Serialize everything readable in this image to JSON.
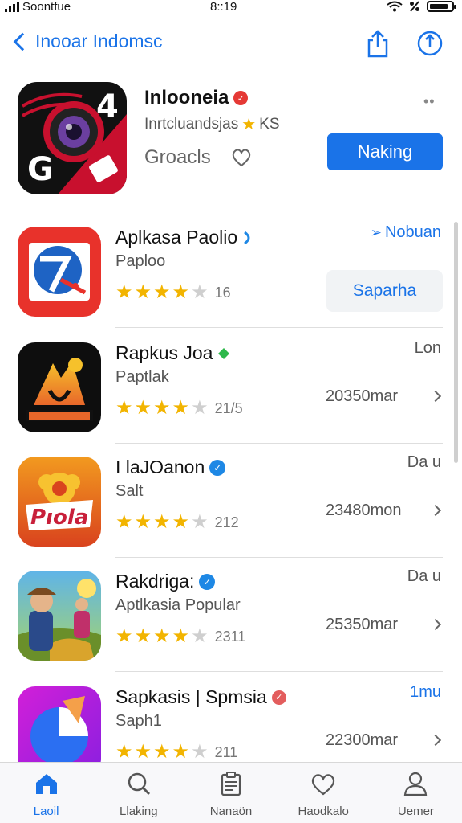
{
  "status_bar": {
    "carrier": "Soontfue",
    "time": "8::19"
  },
  "nav": {
    "back_label": "Inooar Indomsc"
  },
  "featured": {
    "title": "Inlooneia",
    "subtitle": "Inrtcluandsjas",
    "rating_suffix": "KS",
    "category": "Groacls",
    "button_label": "Naking",
    "more": "••"
  },
  "apps": [
    {
      "name": "Aplkasa Paolio",
      "subtitle": "Paploo",
      "rating_count": "16",
      "action_label": "Nobuan",
      "button_label": "Saparha",
      "stars": 4
    },
    {
      "name": "Rapkus Joa",
      "subtitle": "Paptlak",
      "rating_count": "21/5",
      "action_label": "Lon",
      "price": "20350mar",
      "stars": 4
    },
    {
      "name": "I laJOanon",
      "subtitle": "Salt",
      "rating_count": "212",
      "action_label": "Da u",
      "price": "23480mon",
      "stars": 4
    },
    {
      "name": "Rakdriga:",
      "subtitle": "Aptlkasia Popular",
      "rating_count": "2311",
      "action_label": "Da u",
      "price": "25350mar",
      "stars": 4
    },
    {
      "name": "Sapkasis | Spmsia",
      "subtitle": "Saph1",
      "rating_count": "211",
      "action_label": "1mu",
      "price": "22300mar",
      "stars": 4
    }
  ],
  "tabs": [
    {
      "label": "Laoil",
      "icon": "home-icon",
      "active": true
    },
    {
      "label": "Llaking",
      "icon": "search-icon",
      "active": false
    },
    {
      "label": "Nanaön",
      "icon": "clipboard-icon",
      "active": false
    },
    {
      "label": "Haodkalo",
      "icon": "heart-icon",
      "active": false
    },
    {
      "label": "Uemer",
      "icon": "user-icon",
      "active": false
    }
  ],
  "colors": {
    "accent": "#1a73e8",
    "star": "#f2b400",
    "badge_red": "#e53935"
  }
}
